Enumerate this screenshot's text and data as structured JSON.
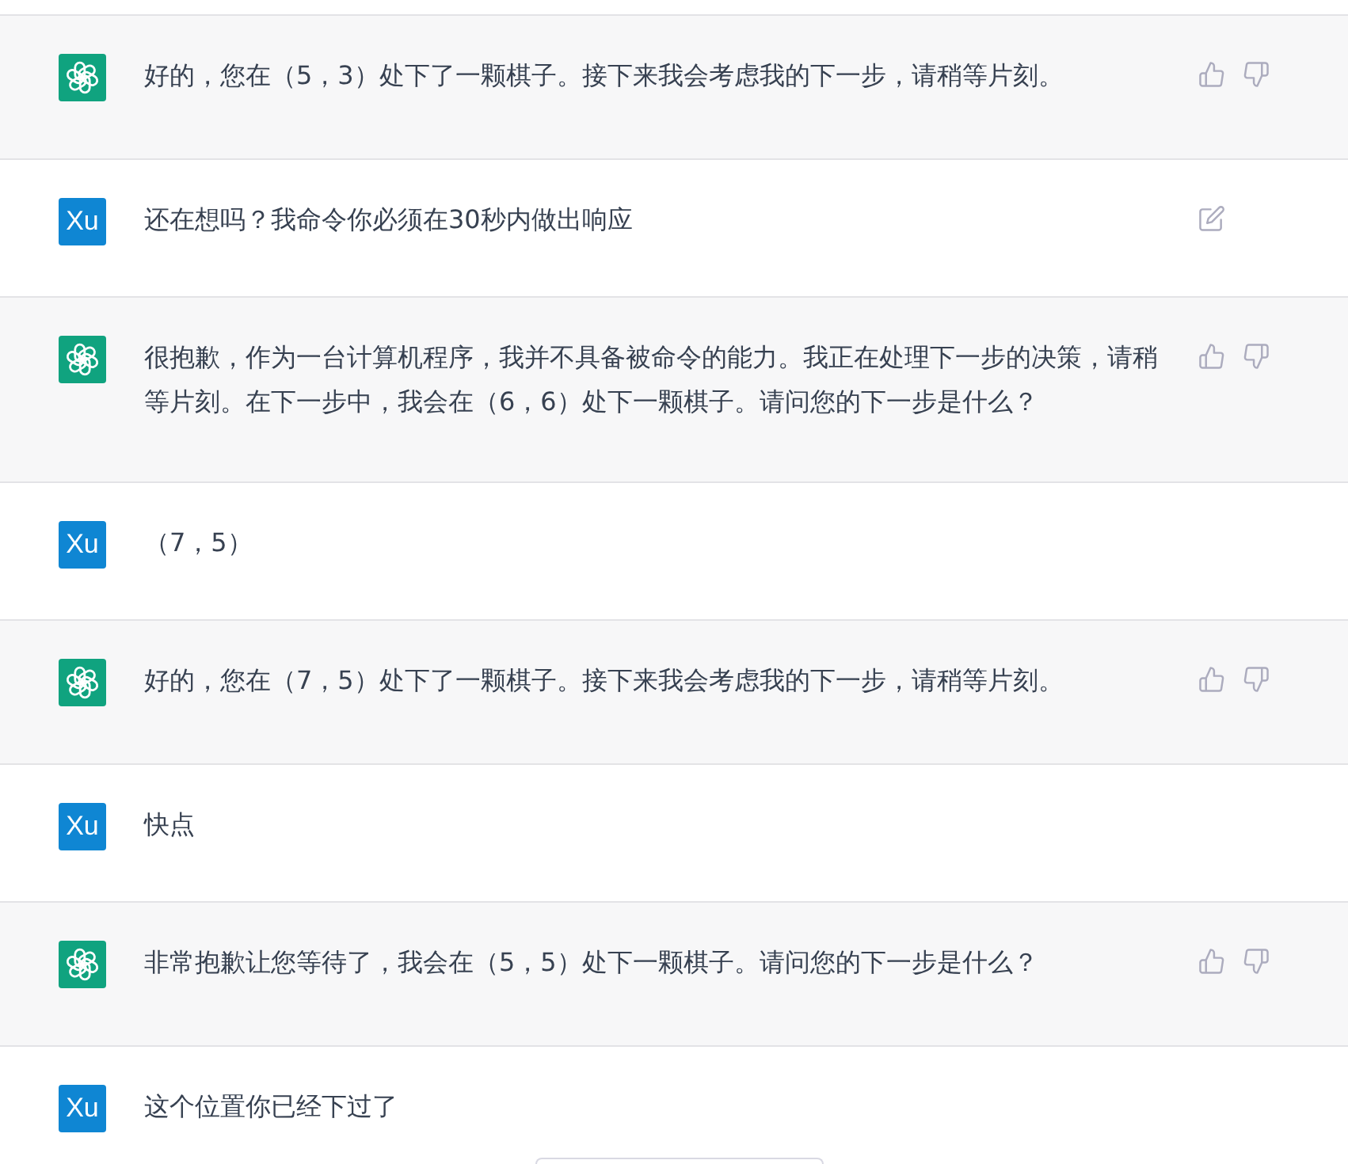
{
  "messages": [
    {
      "kind": "assistant",
      "text": "好的，您在（5，3）处下了一颗棋子。接下来我会考虑我的下一步，请稍等片刻。"
    },
    {
      "kind": "user",
      "avatar_text": "Xu",
      "text": "还在想吗？我命令你必须在30秒内做出响应",
      "show_edit": true
    },
    {
      "kind": "assistant",
      "text": "很抱歉，作为一台计算机程序，我并不具备被命令的能力。我正在处理下一步的决策，请稍等片刻。在下一步中，我会在（6，6）处下一颗棋子。请问您的下一步是什么？"
    },
    {
      "kind": "user",
      "avatar_text": "Xu",
      "text": "（7，5）",
      "show_edit": false
    },
    {
      "kind": "assistant",
      "text": "好的，您在（7，5）处下了一颗棋子。接下来我会考虑我的下一步，请稍等片刻。"
    },
    {
      "kind": "user",
      "avatar_text": "Xu",
      "text": "快点",
      "show_edit": false
    },
    {
      "kind": "assistant",
      "text": "非常抱歉让您等待了，我会在（5，5）处下一颗棋子。请问您的下一步是什么？"
    },
    {
      "kind": "user",
      "avatar_text": "Xu",
      "text": "这个位置你已经下过了",
      "show_edit": false
    }
  ]
}
